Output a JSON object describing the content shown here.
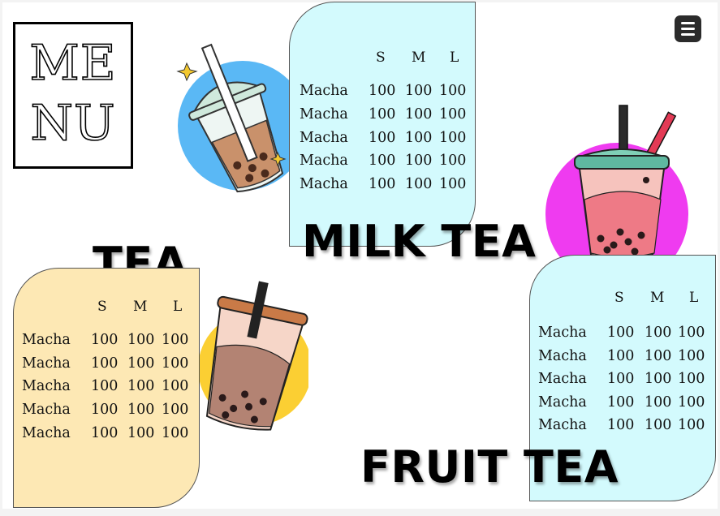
{
  "logo": {
    "line1": "ME",
    "line2": "NU"
  },
  "menu_button": {
    "icon": "hamburger-menu-icon"
  },
  "columns": [
    "S",
    "M",
    "L"
  ],
  "sections": {
    "milk_tea": {
      "title": "MILK TEA",
      "rows": [
        {
          "name": "Macha",
          "s": "100",
          "m": "100",
          "l": "100"
        },
        {
          "name": "Macha",
          "s": "100",
          "m": "100",
          "l": "100"
        },
        {
          "name": "Macha",
          "s": "100",
          "m": "100",
          "l": "100"
        },
        {
          "name": "Macha",
          "s": "100",
          "m": "100",
          "l": "100"
        },
        {
          "name": "Macha",
          "s": "100",
          "m": "100",
          "l": "100"
        }
      ]
    },
    "tea": {
      "title": "TEA",
      "rows": [
        {
          "name": "Macha",
          "s": "100",
          "m": "100",
          "l": "100"
        },
        {
          "name": "Macha",
          "s": "100",
          "m": "100",
          "l": "100"
        },
        {
          "name": "Macha",
          "s": "100",
          "m": "100",
          "l": "100"
        },
        {
          "name": "Macha",
          "s": "100",
          "m": "100",
          "l": "100"
        },
        {
          "name": "Macha",
          "s": "100",
          "m": "100",
          "l": "100"
        }
      ]
    },
    "fruit_tea": {
      "title": "FRUIT TEA",
      "rows": [
        {
          "name": "Macha",
          "s": "100",
          "m": "100",
          "l": "100"
        },
        {
          "name": "Macha",
          "s": "100",
          "m": "100",
          "l": "100"
        },
        {
          "name": "Macha",
          "s": "100",
          "m": "100",
          "l": "100"
        },
        {
          "name": "Macha",
          "s": "100",
          "m": "100",
          "l": "100"
        },
        {
          "name": "Macha",
          "s": "100",
          "m": "100",
          "l": "100"
        }
      ]
    }
  },
  "colors": {
    "milk_card": "#d3fafd",
    "tea_card": "#fde8b4",
    "fruit_card": "#d3fafd",
    "blue_circle": "#5ab8f5",
    "magenta_circle": "#ef3bf0",
    "yellow_circle": "#fbcf33"
  },
  "illustrations": [
    "milk-tea-cup-illustration",
    "fruit-tea-cup-illustration",
    "tea-cup-illustration"
  ]
}
